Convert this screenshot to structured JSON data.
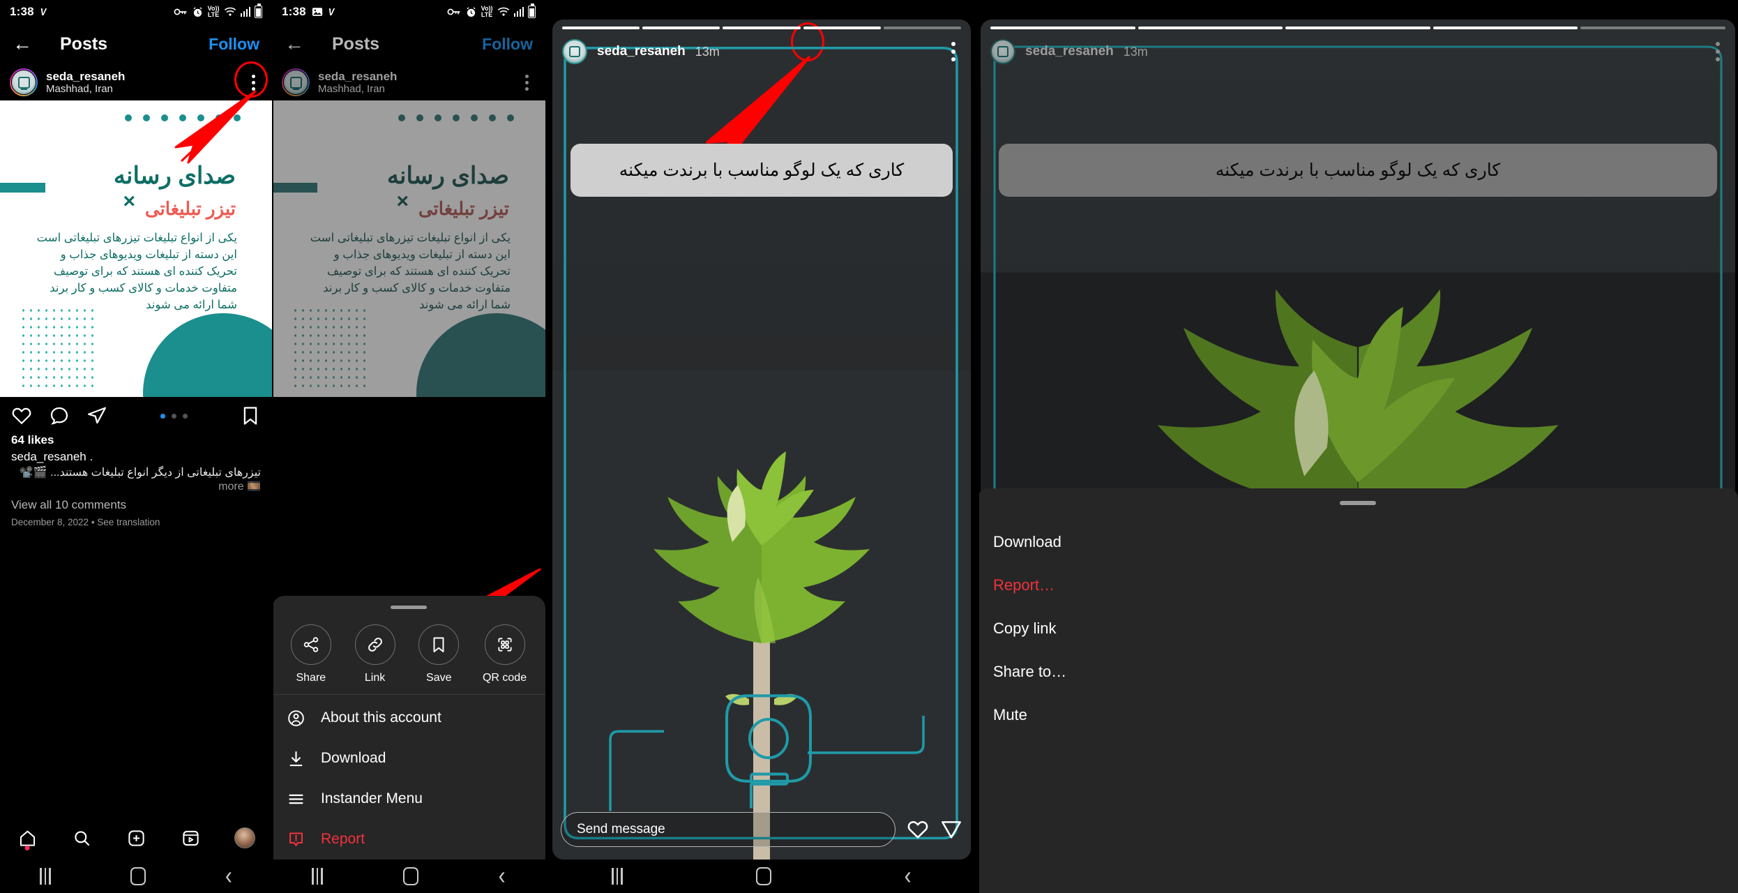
{
  "statusbar": {
    "time": "1:38",
    "icons_left": [
      "image-icon",
      "vpn-v-icon"
    ],
    "icons_right": [
      "vpn-key-icon",
      "alarm-icon",
      "volte-icon",
      "wifi-icon",
      "signal-icon",
      "battery-icon"
    ],
    "volte_label_top": "Vo))",
    "volte_label_bottom": "LTE"
  },
  "panel1": {
    "topbar": {
      "back": "←",
      "title": "Posts",
      "follow": "Follow"
    },
    "post_header": {
      "username": "seda_resaneh",
      "location": "Mashhad, Iran",
      "menu": "kebab-menu"
    },
    "post_image": {
      "title_fa": "صدای رسانه",
      "x_mark": "×",
      "subtitle_fa": "تیزر تبلیغاتی",
      "body_fa": "یکی از انواع تبلیغات تیزرهای تبلیغاتی است\nاین دسته از تبلیغات ویدیوهای جذاب و تحریک کننده ای هستند که برای توصیف متفاوت خدمات و کالای کسب و کار برند شما ارائه می شوند"
    },
    "actions": [
      "like-icon",
      "comment-icon",
      "share-icon",
      "bookmark-icon"
    ],
    "caption": {
      "likes": "64 likes",
      "username": "seda_resaneh",
      "dot": ".",
      "text_fa": "تیزرهای تبلیغاتی از دیگر انواع تبلیغات هستند... 🎬📽️🎞️",
      "more": "more",
      "view_comments": "View all 10 comments",
      "date": "December 8, 2022 • See translation"
    },
    "bottom_nav": [
      "home-icon",
      "search-icon",
      "create-icon",
      "reels-icon",
      "profile-avatar"
    ]
  },
  "panel2": {
    "topbar": {
      "back": "←",
      "title": "Posts",
      "follow": "Follow"
    },
    "post_header": {
      "username": "seda_resaneh",
      "location": "Mashhad, Iran",
      "menu": "kebab-menu"
    },
    "sheet": {
      "quick_actions": [
        {
          "label": "Share",
          "icon": "share-node-icon"
        },
        {
          "label": "Link",
          "icon": "link-icon"
        },
        {
          "label": "Save",
          "icon": "bookmark-icon"
        },
        {
          "label": "QR code",
          "icon": "qr-code-icon"
        }
      ],
      "menu_items": [
        {
          "label": "About this account",
          "icon": "account-circle-icon",
          "danger": false
        },
        {
          "label": "Download",
          "icon": "download-icon",
          "danger": false
        },
        {
          "label": "Instander Menu",
          "icon": "hamburger-icon",
          "danger": false
        },
        {
          "label": "Report",
          "icon": "report-icon",
          "danger": true
        }
      ]
    }
  },
  "panel3": {
    "story_header": {
      "username": "seda_resaneh",
      "time": "13m",
      "menu": "kebab-menu"
    },
    "caption_fa": "کاری که یک لوگو مناسب با برندت میکنه",
    "send": {
      "placeholder": "Send message",
      "like": "heart-icon",
      "share": "paper-plane-icon"
    },
    "progress_segments": 5
  },
  "panel4": {
    "story_header": {
      "username": "seda_resaneh",
      "time": "13m",
      "menu": "kebab-menu"
    },
    "caption_fa": "کاری که یک لوگو مناسب با برندت میکنه",
    "sheet_items": [
      {
        "label": "Download",
        "danger": false
      },
      {
        "label": "Report…",
        "danger": true
      },
      {
        "label": "Copy link",
        "danger": false
      },
      {
        "label": "Share to…",
        "danger": false
      },
      {
        "label": "Mute",
        "danger": false
      }
    ],
    "progress_segments": 5
  },
  "sysnav": {
    "recents": "recents-icon",
    "home": "home-square-icon",
    "back": "back-chevron-icon"
  },
  "colors": {
    "accent_teal": "#1b8e8e",
    "brand_red": "#ef5a52",
    "link_blue": "#1c90f3",
    "highlight_red": "#ff0000",
    "sheet_bg": "#262626",
    "danger": "#f0323c"
  }
}
